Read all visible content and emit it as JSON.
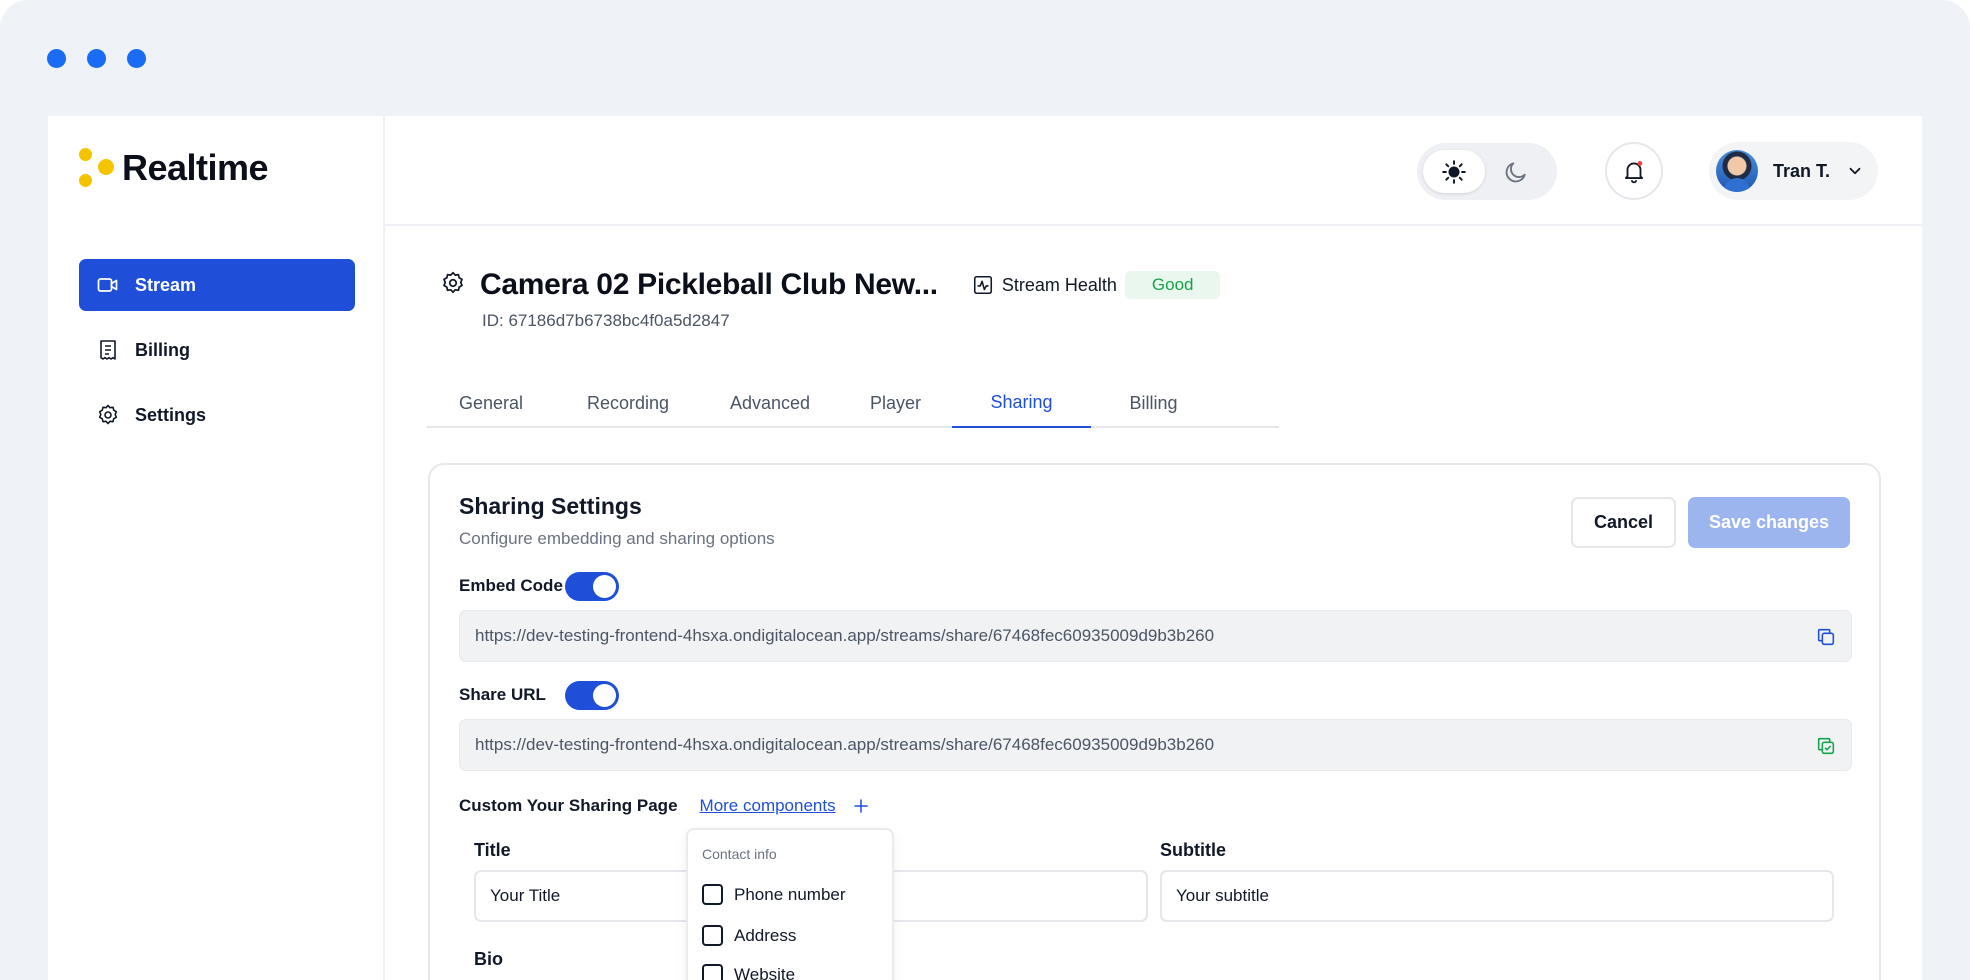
{
  "brand": {
    "name": "Realtime",
    "accent": "#1f4fd8",
    "logo_color": "#f5c400"
  },
  "sidebar": {
    "items": [
      {
        "label": "Stream",
        "icon": "video-camera-icon",
        "active": true
      },
      {
        "label": "Billing",
        "icon": "receipt-icon",
        "active": false
      },
      {
        "label": "Settings",
        "icon": "gear-icon",
        "active": false
      }
    ]
  },
  "header": {
    "theme": {
      "selected": "light",
      "options": [
        "sun-icon",
        "moon-icon"
      ]
    },
    "notifications_icon": "bell-icon",
    "user": {
      "name": "Tran T.",
      "avatar": "avatar"
    }
  },
  "stream": {
    "title": "Camera 02 Pickleball Club New...",
    "id_text": "ID: 67186d7b6738bc4f0a5d2847",
    "health_label": "Stream Health",
    "health_status": "Good"
  },
  "tabs": [
    {
      "label": "General",
      "active": false
    },
    {
      "label": "Recording",
      "active": false
    },
    {
      "label": "Advanced",
      "active": false
    },
    {
      "label": "Player",
      "active": false
    },
    {
      "label": "Sharing",
      "active": true
    },
    {
      "label": "Billing",
      "active": false
    }
  ],
  "sharing": {
    "title": "Sharing Settings",
    "subtitle": "Configure embedding and sharing options",
    "cancel_label": "Cancel",
    "save_label": "Save changes",
    "embed": {
      "label": "Embed Code",
      "enabled": true,
      "value": "https://dev-testing-frontend-4hsxa.ondigitalocean.app/streams/share/67468fec60935009d9b3b260"
    },
    "share": {
      "label": "Share URL",
      "enabled": true,
      "value": "https://dev-testing-frontend-4hsxa.ondigitalocean.app/streams/share/67468fec60935009d9b3b260"
    },
    "custom_label": "Custom Your Sharing Page",
    "more_components": "More components",
    "fields": {
      "title_label": "Title",
      "title_value": "Your Title",
      "subtitle_label": "Subtitle",
      "subtitle_value": "Your subtitle",
      "bio_label": "Bio"
    },
    "dropdown": {
      "heading": "Contact info",
      "options": [
        {
          "label": "Phone number",
          "checked": false
        },
        {
          "label": "Address",
          "checked": false
        },
        {
          "label": "Website",
          "checked": false
        }
      ]
    }
  }
}
